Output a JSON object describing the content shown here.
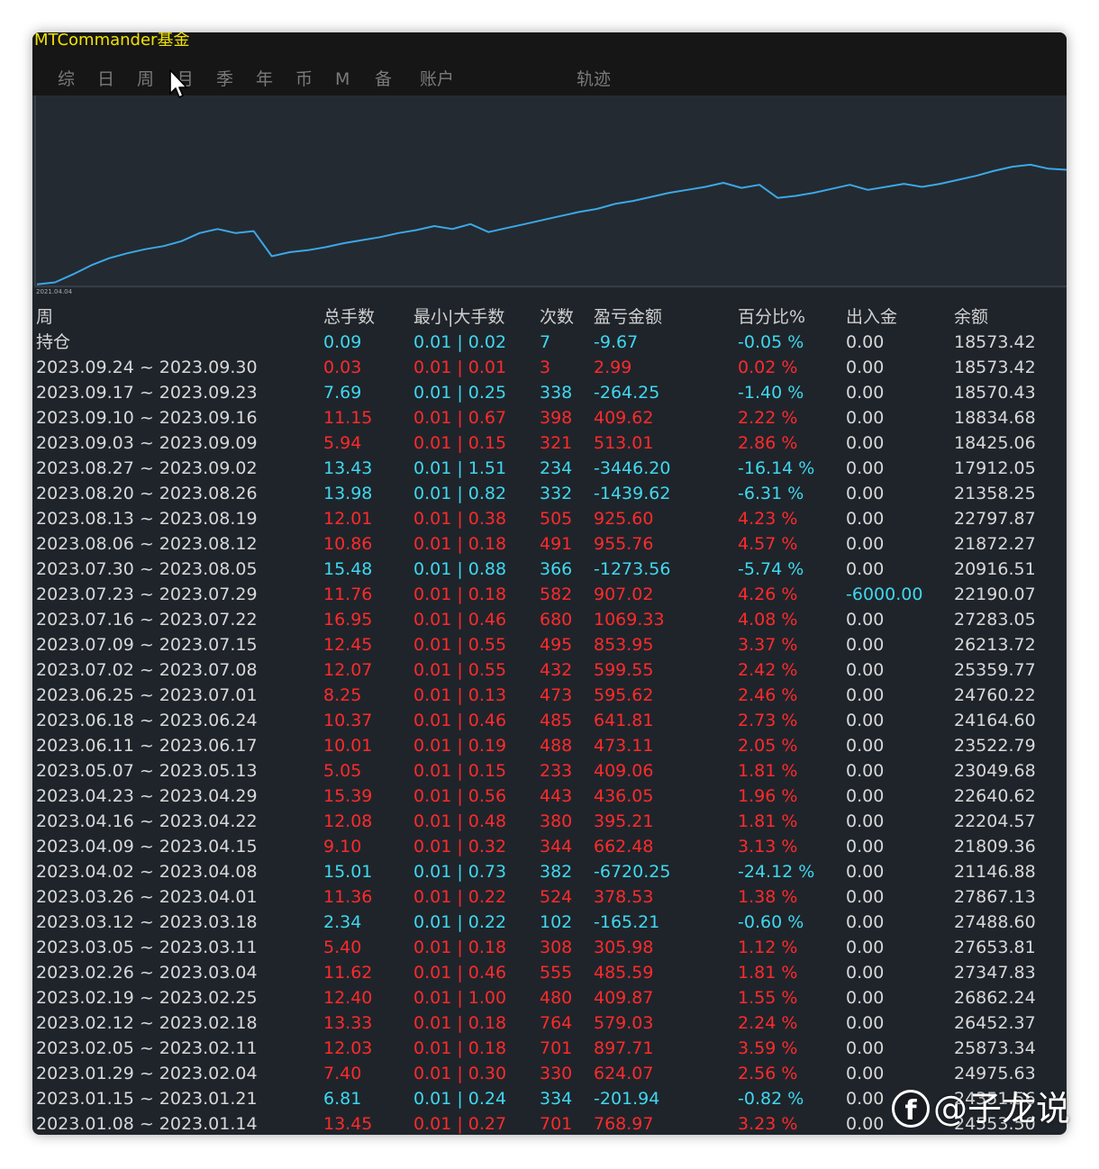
{
  "app": {
    "title": "MTCommander基金"
  },
  "tabs": [
    "综",
    "日",
    "周",
    "月",
    "季",
    "年",
    "币",
    "M",
    "备",
    "账户",
    "轨迹"
  ],
  "chart_data": {
    "type": "line",
    "x_label_start": "2021.04.04",
    "color": "#3aa8e8",
    "values": [
      2,
      4,
      12,
      21,
      28,
      33,
      37,
      40,
      45,
      53,
      57,
      53,
      55,
      30,
      34,
      36,
      39,
      43,
      46,
      49,
      53,
      56,
      60,
      57,
      62,
      54,
      58,
      62,
      66,
      70,
      74,
      77,
      82,
      85,
      89,
      93,
      96,
      99,
      103,
      98,
      101,
      88,
      90,
      93,
      97,
      101,
      96,
      99,
      102,
      99,
      102,
      106,
      110,
      115,
      119,
      121,
      117,
      116
    ]
  },
  "table": {
    "headers": [
      "周",
      "总手数",
      "最小|大手数",
      "次数",
      "盈亏金额",
      "百分比%",
      "出入金",
      "余额"
    ],
    "rows": [
      [
        "持仓",
        "0.09",
        "0.01 | 0.02",
        "7",
        "-9.67",
        "-0.05 %",
        "0.00",
        "18573.42"
      ],
      [
        "2023.09.24 ~ 2023.09.30",
        "0.03",
        "0.01 | 0.01",
        "3",
        "2.99",
        "0.02 %",
        "0.00",
        "18573.42"
      ],
      [
        "2023.09.17 ~ 2023.09.23",
        "7.69",
        "0.01 | 0.25",
        "338",
        "-264.25",
        "-1.40 %",
        "0.00",
        "18570.43"
      ],
      [
        "2023.09.10 ~ 2023.09.16",
        "11.15",
        "0.01 | 0.67",
        "398",
        "409.62",
        "2.22 %",
        "0.00",
        "18834.68"
      ],
      [
        "2023.09.03 ~ 2023.09.09",
        "5.94",
        "0.01 | 0.15",
        "321",
        "513.01",
        "2.86 %",
        "0.00",
        "18425.06"
      ],
      [
        "2023.08.27 ~ 2023.09.02",
        "13.43",
        "0.01 | 1.51",
        "234",
        "-3446.20",
        "-16.14 %",
        "0.00",
        "17912.05"
      ],
      [
        "2023.08.20 ~ 2023.08.26",
        "13.98",
        "0.01 | 0.82",
        "332",
        "-1439.62",
        "-6.31 %",
        "0.00",
        "21358.25"
      ],
      [
        "2023.08.13 ~ 2023.08.19",
        "12.01",
        "0.01 | 0.38",
        "505",
        "925.60",
        "4.23 %",
        "0.00",
        "22797.87"
      ],
      [
        "2023.08.06 ~ 2023.08.12",
        "10.86",
        "0.01 | 0.18",
        "491",
        "955.76",
        "4.57 %",
        "0.00",
        "21872.27"
      ],
      [
        "2023.07.30 ~ 2023.08.05",
        "15.48",
        "0.01 | 0.88",
        "366",
        "-1273.56",
        "-5.74 %",
        "0.00",
        "20916.51"
      ],
      [
        "2023.07.23 ~ 2023.07.29",
        "11.76",
        "0.01 | 0.18",
        "582",
        "907.02",
        "4.26 %",
        "-6000.00",
        "22190.07"
      ],
      [
        "2023.07.16 ~ 2023.07.22",
        "16.95",
        "0.01 | 0.46",
        "680",
        "1069.33",
        "4.08 %",
        "0.00",
        "27283.05"
      ],
      [
        "2023.07.09 ~ 2023.07.15",
        "12.45",
        "0.01 | 0.55",
        "495",
        "853.95",
        "3.37 %",
        "0.00",
        "26213.72"
      ],
      [
        "2023.07.02 ~ 2023.07.08",
        "12.07",
        "0.01 | 0.55",
        "432",
        "599.55",
        "2.42 %",
        "0.00",
        "25359.77"
      ],
      [
        "2023.06.25 ~ 2023.07.01",
        "8.25",
        "0.01 | 0.13",
        "473",
        "595.62",
        "2.46 %",
        "0.00",
        "24760.22"
      ],
      [
        "2023.06.18 ~ 2023.06.24",
        "10.37",
        "0.01 | 0.46",
        "485",
        "641.81",
        "2.73 %",
        "0.00",
        "24164.60"
      ],
      [
        "2023.06.11 ~ 2023.06.17",
        "10.01",
        "0.01 | 0.19",
        "488",
        "473.11",
        "2.05 %",
        "0.00",
        "23522.79"
      ],
      [
        "2023.05.07 ~ 2023.05.13",
        "5.05",
        "0.01 | 0.15",
        "233",
        "409.06",
        "1.81 %",
        "0.00",
        "23049.68"
      ],
      [
        "2023.04.23 ~ 2023.04.29",
        "15.39",
        "0.01 | 0.56",
        "443",
        "436.05",
        "1.96 %",
        "0.00",
        "22640.62"
      ],
      [
        "2023.04.16 ~ 2023.04.22",
        "12.08",
        "0.01 | 0.48",
        "380",
        "395.21",
        "1.81 %",
        "0.00",
        "22204.57"
      ],
      [
        "2023.04.09 ~ 2023.04.15",
        "9.10",
        "0.01 | 0.32",
        "344",
        "662.48",
        "3.13 %",
        "0.00",
        "21809.36"
      ],
      [
        "2023.04.02 ~ 2023.04.08",
        "15.01",
        "0.01 | 0.73",
        "382",
        "-6720.25",
        "-24.12 %",
        "0.00",
        "21146.88"
      ],
      [
        "2023.03.26 ~ 2023.04.01",
        "11.36",
        "0.01 | 0.22",
        "524",
        "378.53",
        "1.38 %",
        "0.00",
        "27867.13"
      ],
      [
        "2023.03.12 ~ 2023.03.18",
        "2.34",
        "0.01 | 0.22",
        "102",
        "-165.21",
        "-0.60 %",
        "0.00",
        "27488.60"
      ],
      [
        "2023.03.05 ~ 2023.03.11",
        "5.40",
        "0.01 | 0.18",
        "308",
        "305.98",
        "1.12 %",
        "0.00",
        "27653.81"
      ],
      [
        "2023.02.26 ~ 2023.03.04",
        "11.62",
        "0.01 | 0.46",
        "555",
        "485.59",
        "1.81 %",
        "0.00",
        "27347.83"
      ],
      [
        "2023.02.19 ~ 2023.02.25",
        "12.40",
        "0.01 | 1.00",
        "480",
        "409.87",
        "1.55 %",
        "0.00",
        "26862.24"
      ],
      [
        "2023.02.12 ~ 2023.02.18",
        "13.33",
        "0.01 | 0.18",
        "764",
        "579.03",
        "2.24 %",
        "0.00",
        "26452.37"
      ],
      [
        "2023.02.05 ~ 2023.02.11",
        "12.03",
        "0.01 | 0.18",
        "701",
        "897.71",
        "3.59 %",
        "0.00",
        "25873.34"
      ],
      [
        "2023.01.29 ~ 2023.02.04",
        "7.40",
        "0.01 | 0.30",
        "330",
        "624.07",
        "2.56 %",
        "0.00",
        "24975.63"
      ],
      [
        "2023.01.15 ~ 2023.01.21",
        "6.81",
        "0.01 | 0.24",
        "334",
        "-201.94",
        "-0.82 %",
        "0.00",
        "24351.56"
      ],
      [
        "2023.01.08 ~ 2023.01.14",
        "13.45",
        "0.01 | 0.27",
        "701",
        "768.97",
        "3.23 %",
        "0.00",
        "24553.50"
      ]
    ]
  },
  "colors": {
    "positive": "#ff2a2a",
    "negative": "#3fd8ee",
    "neutral": "#d8d8d8",
    "title": "#f2e200",
    "line": "#3aa8e8"
  },
  "watermark": {
    "logo": "f",
    "text": "@子龙说"
  }
}
